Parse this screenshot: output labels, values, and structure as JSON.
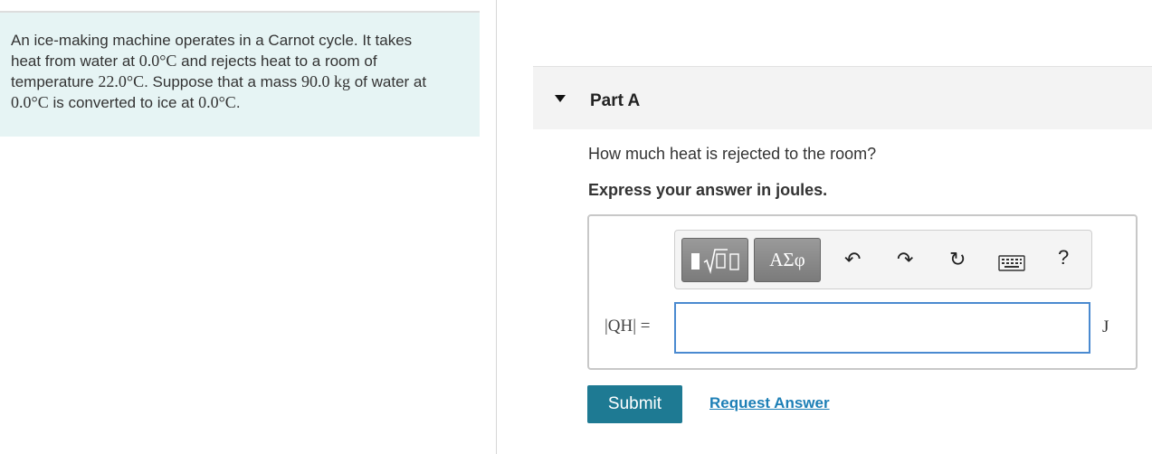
{
  "problem": {
    "segments": [
      "An ice-making machine operates in a Carnot cycle. It takes heat from water at ",
      "0.0°C",
      " and rejects heat to a room of temperature ",
      "22.0°C",
      ". Suppose that a mass ",
      "90.0 kg",
      " of water at ",
      "0.0°C",
      " is converted to ice at ",
      "0.0°C",
      "."
    ]
  },
  "part": {
    "title": "Part A"
  },
  "question": "How much heat is rejected to the room?",
  "instruction": "Express your answer in joules.",
  "toolbar": {
    "greek_label": "ΑΣφ",
    "undo": "↶",
    "redo": "↷",
    "reset": "↻",
    "help": "?"
  },
  "equation": {
    "label": "|QH| =",
    "value": "",
    "unit": "J"
  },
  "actions": {
    "submit": "Submit",
    "request_answer": "Request Answer"
  }
}
